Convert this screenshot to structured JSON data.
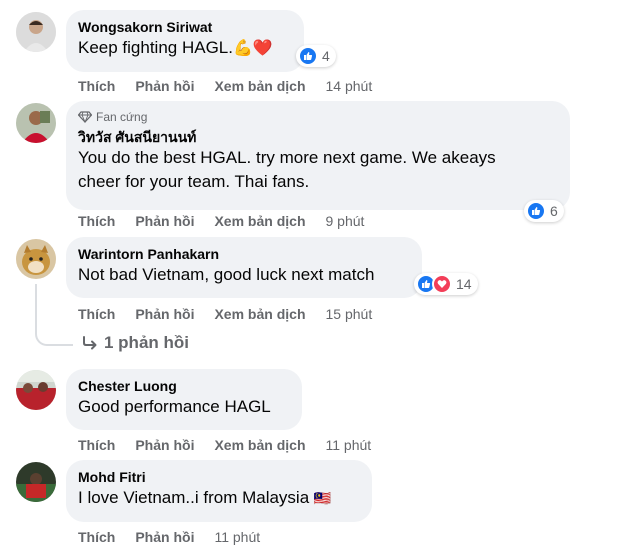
{
  "comments": [
    {
      "author": "Wongsakorn Siriwat",
      "text": "Keep fighting HAGL.",
      "emoji": "💪❤️",
      "reaction_count": "4",
      "actions": {
        "like": "Thích",
        "reply": "Phản hồi",
        "translate": "Xem bản dịch",
        "time": "14 phút"
      }
    },
    {
      "badge": "Fan cứng",
      "author": "วิทวัส ศันสนียานนท์",
      "text_lines": [
        "You do the best HGAL. try more next game. We akeays",
        "cheer for your team. Thai fans."
      ],
      "reaction_count": "6",
      "actions": {
        "like": "Thích",
        "reply": "Phản hồi",
        "translate": "Xem bản dịch",
        "time": "9 phút"
      }
    },
    {
      "author": "Warintorn Panhakarn",
      "text": "Not bad Vietnam, good luck next match",
      "reaction_count": "14",
      "actions": {
        "like": "Thích",
        "reply": "Phản hồi",
        "translate": "Xem bản dịch",
        "time": "15 phút"
      },
      "replies_label": "1 phản hồi"
    },
    {
      "author": "Chester Luong",
      "text": "Good performance HAGL",
      "actions": {
        "like": "Thích",
        "reply": "Phản hồi",
        "translate": "Xem bản dịch",
        "time": "11 phút"
      }
    },
    {
      "author": "Mohd Fitri",
      "text": "I love Vietnam..i from Malaysia",
      "flag": "🇲🇾",
      "actions": {
        "like": "Thích",
        "reply": "Phản hồi",
        "translate": "Xem bản dịch",
        "time": "11 phút"
      }
    }
  ],
  "colors": {
    "bubble": "#f0f2f5",
    "secondary_text": "#65676b",
    "like_blue": "#1877f2",
    "love_red": "#f33e58"
  }
}
